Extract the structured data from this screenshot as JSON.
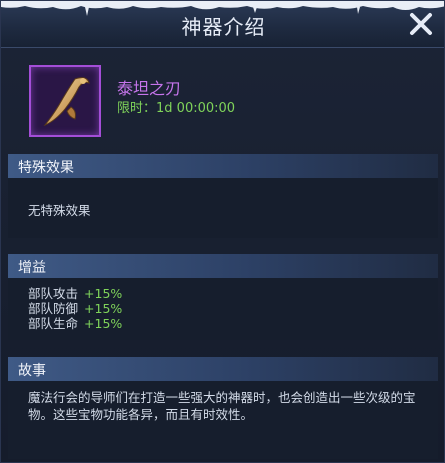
{
  "header": {
    "title": "神器介绍"
  },
  "item": {
    "name": "泰坦之刃",
    "time_label": "限时：",
    "time_value": "1d 00:00:00",
    "icon": "curved-dagger-icon",
    "rarity_color": "#a44ed8"
  },
  "sections": {
    "special": {
      "title": "特殊效果",
      "text": "无特殊效果"
    },
    "buffs": {
      "title": "增益",
      "items": [
        {
          "label": "部队攻击",
          "value": "+15%"
        },
        {
          "label": "部队防御",
          "value": "+15%"
        },
        {
          "label": "部队生命",
          "value": "+15%"
        }
      ]
    },
    "story": {
      "title": "故事",
      "text": "魔法行会的导师们在打造一些强大的神器时，也会创造出一些次级的宝物。这些宝物功能各异，而且有时效性。"
    }
  },
  "colors": {
    "accent_green": "#7fd35a",
    "accent_purple": "#c675ec"
  }
}
